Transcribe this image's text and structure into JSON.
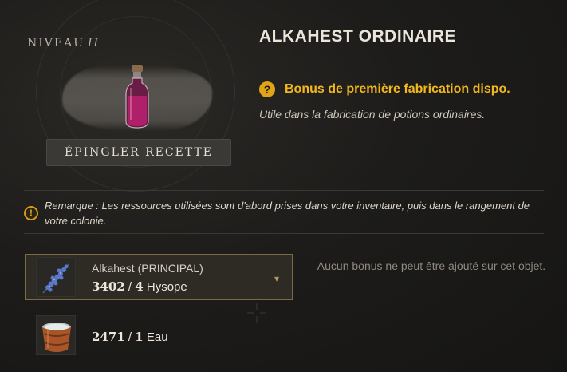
{
  "recipe": {
    "level_label": "NIVEAU",
    "level_value": "II",
    "pin_button": "ÉPINGLER RECETTE",
    "title": "ALKAHEST ORDINAIRE",
    "bonus_text": "Bonus de première fabrication dispo.",
    "description": "Utile dans la fabrication de potions ordinaires."
  },
  "note": {
    "text": "Remarque : Les ressources utilisées sont d'abord prises dans votre inventaire, puis dans le rangement de votre colonie."
  },
  "ingredients": [
    {
      "name": "Alkahest (PRINCIPAL)",
      "have": "3402",
      "need": "4",
      "item": "Hysope",
      "icon": "hyssop-icon"
    },
    {
      "name": "",
      "have": "2471",
      "need": "1",
      "item": "Eau",
      "icon": "water-bucket-icon"
    }
  ],
  "bonus_panel": {
    "text": "Aucun bonus ne peut être ajouté sur cet objet."
  },
  "colors": {
    "accent_gold": "#f2b81c",
    "potion": "#b0206a"
  }
}
